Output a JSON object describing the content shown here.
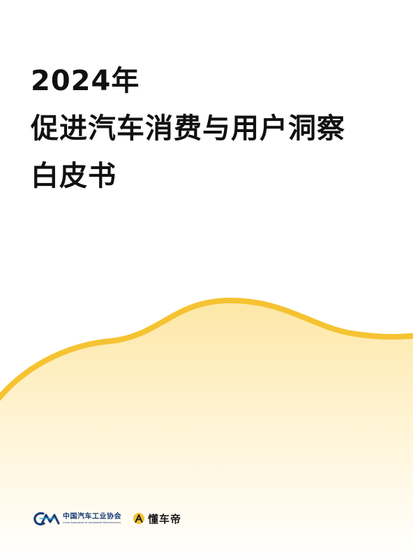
{
  "cover": {
    "title_lines": [
      "2024年",
      "促进汽车消费与用户洞察",
      "白皮书"
    ]
  },
  "logos": {
    "caam": {
      "name_cn": "中国汽车工业协会",
      "name_en": "China Association of Automobile Manufacturers",
      "mark_letters": "CAM",
      "icon": "caam-logo-icon"
    },
    "dongchedi": {
      "name": "懂车帝",
      "icon": "dongchedi-logo-icon"
    }
  },
  "colors": {
    "accent_yellow": "#f5c332",
    "wave_fill_top": "#fde7a6",
    "title_text": "#111111",
    "caam_blue": "#1a3c78"
  }
}
